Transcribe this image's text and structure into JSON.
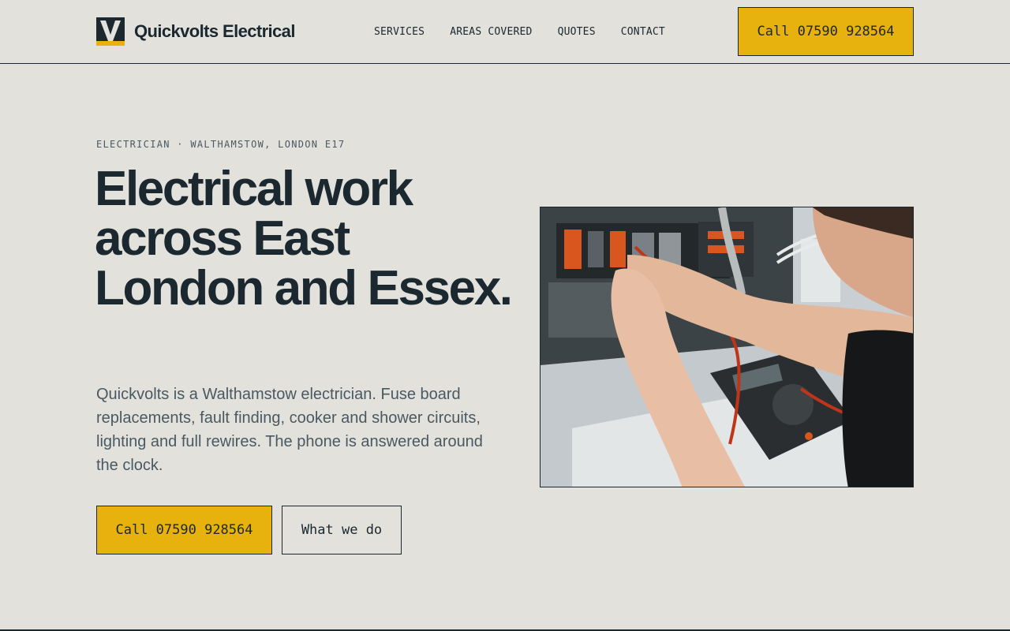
{
  "brand": {
    "name": "Quickvolts Electrical",
    "logo_letter": "V",
    "colors": {
      "accent": "#e8b20e",
      "ink": "#1b2830",
      "background": "#e2e1dc",
      "muted": "#4a5961"
    }
  },
  "nav": {
    "items": [
      {
        "label": "SERVICES"
      },
      {
        "label": "AREAS COVERED"
      },
      {
        "label": "QUOTES"
      },
      {
        "label": "CONTACT"
      }
    ]
  },
  "header": {
    "call_label": "Call 07590 928564"
  },
  "hero": {
    "eyebrow": "ELECTRICIAN · WALTHAMSTOW, LONDON E17",
    "headline": "Electrical work across East London and Essex.",
    "lead": "Quickvolts is a Walthamstow electrician. Fuse board replacements, fault finding, cooker and shower circuits, lighting and full rewires. The phone is answered around the clock.",
    "primary_cta": "Call 07590 928564",
    "secondary_cta": "What we do",
    "image_subject": "electrician testing a consumer unit with a multimeter"
  }
}
